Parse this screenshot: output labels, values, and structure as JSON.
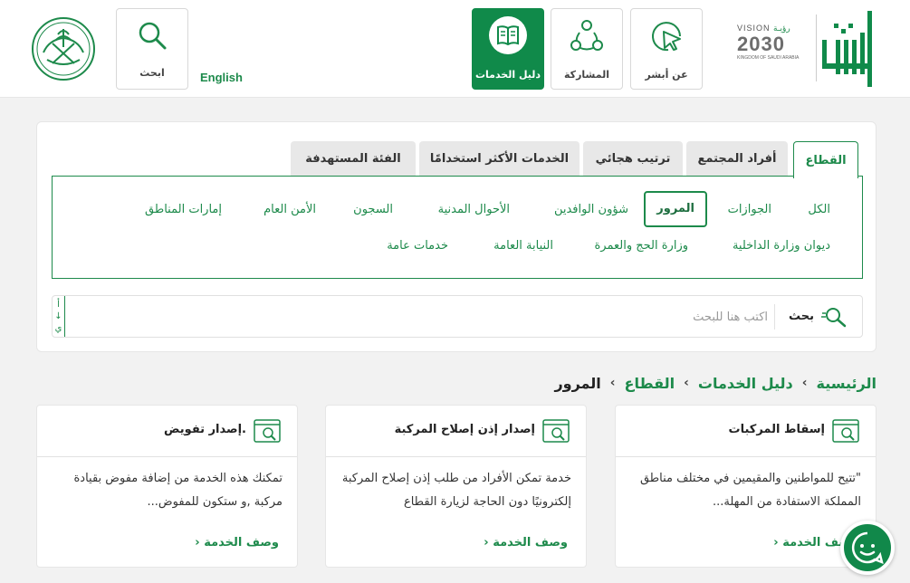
{
  "header": {
    "search_label": "ابحث",
    "english_link": "English",
    "nav": {
      "guide": "دليل الخدمات",
      "participation": "المشاركة",
      "about": "عن أبشر"
    },
    "vision": {
      "arabic": "رؤيـة",
      "prefix": "VISION",
      "year": "2030",
      "kingdom": "KINGDOM OF SAUDI ARABIA"
    },
    "logo_text": "أبشر"
  },
  "filters": {
    "tabs": [
      "القطاع",
      "أفراد المجتمع",
      "ترتيب هجائي",
      "الخدمات الأكثر استخدامًا",
      "الفئة المستهدفة"
    ],
    "active_tab": "القطاع",
    "categories_row1": [
      "الكل",
      "الجوازات",
      "المرور",
      "شؤون الوافدين",
      "الأحوال المدنية",
      "السجون",
      "الأمن العام",
      "إمارات المناطق"
    ],
    "categories_row2": [
      "ديوان وزارة الداخلية",
      "وزارة الحج والعمرة",
      "النيابة العامة",
      "خدمات عامة"
    ],
    "active_category": "المرور",
    "search": {
      "button_label": "بحث",
      "placeholder": "اكتب هنا للبحث",
      "alpha_top": "أ",
      "alpha_arrow": "↓",
      "alpha_bottom": "ي"
    }
  },
  "breadcrumb": [
    "الرئيسية",
    "دليل الخدمات",
    "القطاع",
    "المرور"
  ],
  "cards": [
    {
      "title": "إسقاط المركبات",
      "description": "\"تتيح للمواطنين والمقيمين في مختلف مناطق المملكة الاستفادة من المهلة...",
      "link": "وصف الخدمة"
    },
    {
      "title": "إصدار إذن إصلاح المركبة",
      "description": "خدمة تمكن الأفراد من طلب إذن إصلاح المركبة إلكترونيًا دون الحاجة لزيارة القطاع",
      "link": "وصف الخدمة"
    },
    {
      "title": "إصدار تفويض.",
      "description": "تمكنك هذه الخدمة من إضافة مفوض بقيادة مركبة ,و ستكون للمفوض...",
      "link": "وصف الخدمة"
    }
  ],
  "colors": {
    "brand_green": "#108a4a",
    "link_green": "#1d8a4b",
    "background": "#f2f2f2"
  },
  "icons": {
    "search": "magnifier-icon",
    "guide": "book-icon",
    "participation": "share-network-icon",
    "about": "cursor-click-icon",
    "card": "service-search-icon",
    "chat": "support-chat-icon"
  }
}
